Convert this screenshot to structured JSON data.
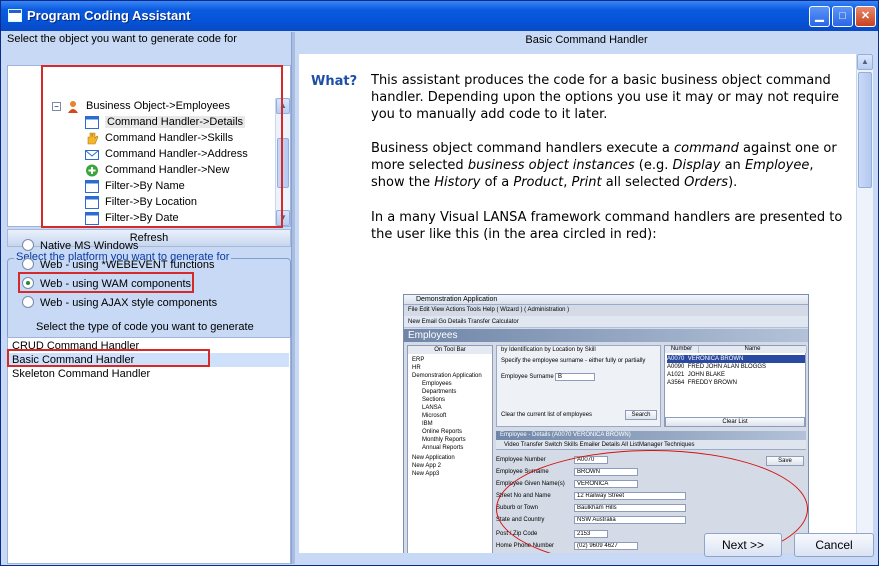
{
  "window": {
    "title": "Program Coding Assistant",
    "minimize_glyph": "▁",
    "maximize_glyph": "□",
    "close_glyph": "✕"
  },
  "left": {
    "object_caption": "Select the object you want to generate code for",
    "tree_root": {
      "label": "Business Object->Employees",
      "expander": "−",
      "icon": "business-object-icon"
    },
    "tree_items": [
      {
        "label": "Command Handler->Details",
        "icon": "window-icon",
        "selected": true
      },
      {
        "label": "Command Handler->Skills",
        "icon": "hand-icon"
      },
      {
        "label": "Command Handler->Address",
        "icon": "envelope-icon"
      },
      {
        "label": "Command Handler->New",
        "icon": "add-circle-icon"
      },
      {
        "label": "Filter->By Name",
        "icon": "window-icon"
      },
      {
        "label": "Filter->By Location",
        "icon": "window-icon"
      },
      {
        "label": "Filter->By Date",
        "icon": "window-icon"
      }
    ],
    "refresh_label": "Refresh",
    "platform_legend": "Select the platform you want to generate for",
    "platforms": [
      {
        "label": "Native MS Windows",
        "checked": false
      },
      {
        "label": "Web - using *WEBEVENT functions",
        "checked": false
      },
      {
        "label": "Web - using WAM components",
        "checked": true
      },
      {
        "label": "Web - using AJAX style components",
        "checked": false
      }
    ],
    "code_caption": "Select the type of code you want to generate",
    "code_types": [
      {
        "label": "CRUD Command Handler",
        "selected": false
      },
      {
        "label": "Basic Command Handler",
        "selected": true
      },
      {
        "label": "Skeleton Command Handler",
        "selected": false
      }
    ]
  },
  "right": {
    "header": "Basic Command Handler",
    "what_label": "What?",
    "para1": "This assistant produces the code for a basic business object command handler. Depending upon the options you use it may or may not require you to manually add code to it later.",
    "para2": {
      "a": "Business object command handlers execute a ",
      "b": "command",
      "c": " against one or more selected ",
      "d": "business object instances",
      "e": " (e.g. ",
      "f": "Display",
      "g": " an ",
      "h": "Employee",
      "i": ", show the ",
      "j": "History",
      "k": " of a ",
      "l": "Product",
      "m": ", ",
      "n": "Print",
      "o": " all selected ",
      "p": "Orders",
      "q": ")."
    },
    "para3": "In a many Visual LANSA framework command handlers are presented to the user like this (in the area circled in red):",
    "next_label": "Next >>",
    "cancel_label": "Cancel"
  },
  "screenshot": {
    "title": "Demonstration Application",
    "menu": "File   Edit   View   Actions   Tools   Help   ( Wizard )   ( Administration )",
    "toolbar": "New    Email    Go    Details    Transfer    Calculator",
    "band": "Employees",
    "side_header": "On Tool Bar",
    "tree": [
      "ERP",
      "HR",
      "Demonstration Application",
      "Employees",
      "Departments",
      "Sections",
      "LANSA",
      "Microsoft",
      "IBM",
      "Online Reports",
      "Monthly Reports",
      "Annual Reports",
      "New Application",
      "New App 2",
      "New App3"
    ],
    "filter_tabs": "by Identification    by Location    by Skill",
    "search_caption": "Specify the employee surname - either fully or partially",
    "surname_label": "Employee Surname",
    "surname_value": "B",
    "clear_label": "Clear the current list of employees",
    "search_button": "Search",
    "list_headers": [
      "Number",
      "Name"
    ],
    "list_rows": [
      {
        "number": "A0070",
        "name": "VERONICA BROWN",
        "selected": true
      },
      {
        "number": "A0090",
        "name": "FRED JOHN ALAN BLOGGS"
      },
      {
        "number": "A1021",
        "name": "JOHN BLAKE"
      },
      {
        "number": "A3564",
        "name": "FREDDY BROWN"
      }
    ],
    "clear_list": "Clear List",
    "detail_title": "Employee - Details (A0070 VERONICA BROWN)",
    "detail_tabs": "Video   Transfer   Switch   Skills   Emailer   Details   All ListManager Techniques",
    "save_button": "Save",
    "fields": [
      {
        "label": "Employee Number",
        "value": "A0070"
      },
      {
        "label": "Employee Surname",
        "value": "BROWN"
      },
      {
        "label": "Employee Given Name(s)",
        "value": "VERONICA"
      },
      {
        "label": "Street No and Name",
        "value": "12 Railway Street"
      },
      {
        "label": "Suburb or Town",
        "value": "Baulkham Hills"
      },
      {
        "label": "State and Country",
        "value": "NSW Australia"
      },
      {
        "label": "Post / Zip Code",
        "value": "2153"
      },
      {
        "label": "Home Phone Number",
        "value": "(02) 9609 4627"
      }
    ]
  }
}
